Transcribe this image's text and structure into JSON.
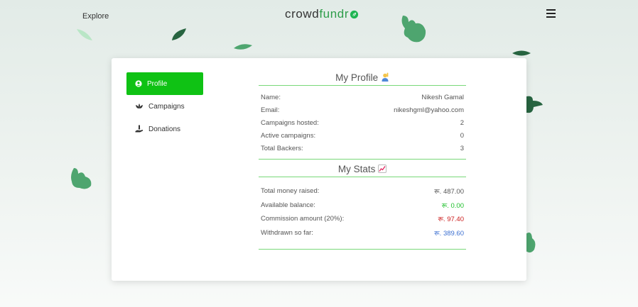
{
  "header": {
    "explore_label": "Explore",
    "logo_prefix": "crowd",
    "logo_accent": "fundr"
  },
  "sidebar": {
    "items": [
      {
        "label": "Profile",
        "icon": "user-circle-icon",
        "active": true
      },
      {
        "label": "Campaigns",
        "icon": "lotus-icon",
        "active": false
      },
      {
        "label": "Donations",
        "icon": "donation-hand-icon",
        "active": false
      }
    ]
  },
  "profile": {
    "title": "My Profile",
    "title_icon": "raising-hand-emoji",
    "rows": [
      {
        "label": "Name:",
        "value": "Nikesh Gamal"
      },
      {
        "label": "Email:",
        "value": "nikeshgml@yahoo.com"
      },
      {
        "label": "Campaigns hosted:",
        "value": "2"
      },
      {
        "label": "Active campaigns:",
        "value": "0"
      },
      {
        "label": "Total Backers:",
        "value": "3"
      }
    ]
  },
  "stats": {
    "title": "My Stats",
    "title_icon": "chart-increasing-emoji",
    "rows": [
      {
        "label": "Total money raised:",
        "value": "रू. 487.00"
      },
      {
        "label": "Available balance:",
        "value": "रू. 0.00"
      },
      {
        "label": "Commission amount (20%):",
        "value": "रू. 97.40"
      },
      {
        "label": "Withdrawn so far:",
        "value": "रू. 389.60"
      }
    ]
  },
  "colors": {
    "accent": "#0fc214",
    "brand": "#2e9d4a",
    "positive": "#1dbf2a",
    "negative": "#cc1c1c",
    "info": "#3b6fd1",
    "divider": "#79d879"
  }
}
